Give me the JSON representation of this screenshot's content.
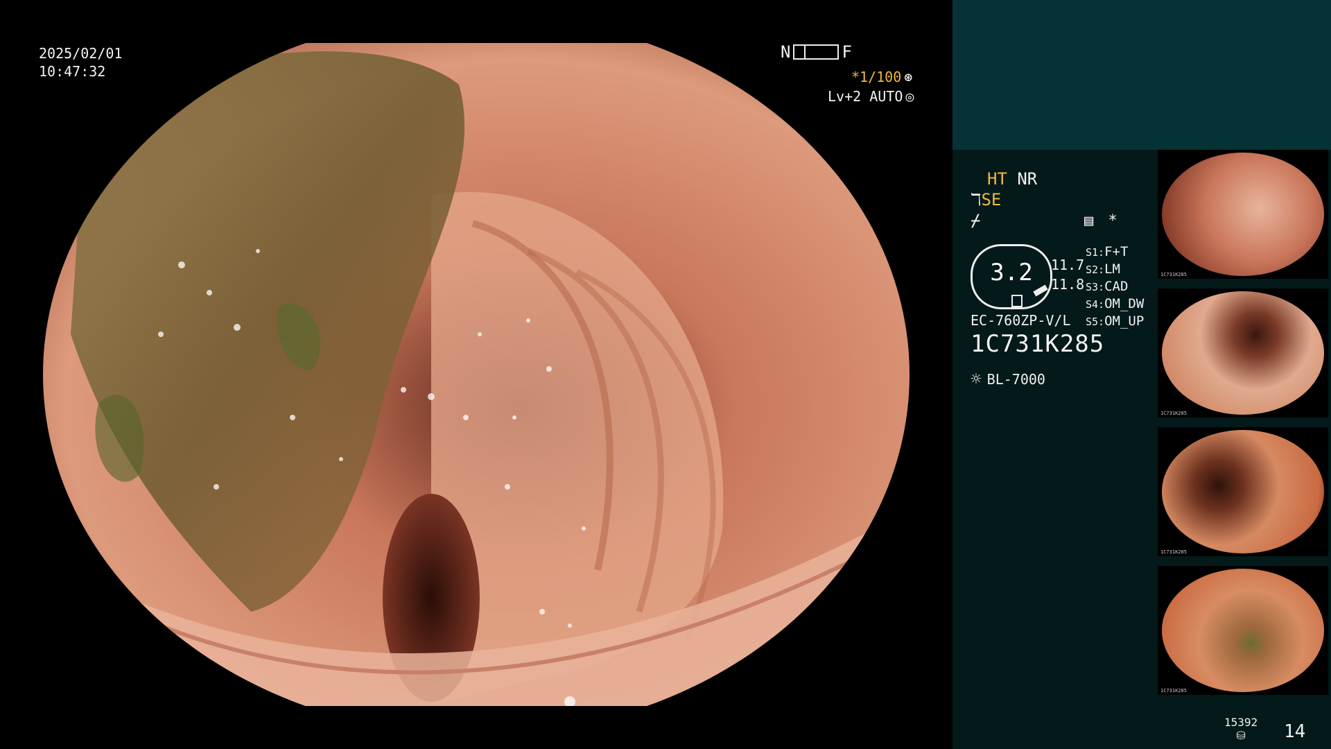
{
  "overlay": {
    "date": "2025/02/01",
    "time": "10:47:32",
    "near_label": "N",
    "far_label": "F",
    "shutter": "*1/100",
    "shutter_icon": "aperture-icon",
    "level": "Lv+2 AUTO",
    "level_icon": "auto-target-icon"
  },
  "panel": {
    "ht": "HT",
    "nr": "NR",
    "se": "SE",
    "settings_star": "*",
    "gauge_value": "3.2",
    "gauge_right_1": "11.7",
    "gauge_right_2": "11.8",
    "slots": [
      {
        "key": "S1:",
        "value": "F+T"
      },
      {
        "key": "S2:",
        "value": "LM"
      },
      {
        "key": "S3:",
        "value": "CAD"
      },
      {
        "key": "S4:",
        "value": "OM_DW"
      },
      {
        "key": "S5:",
        "value": "OM_UP"
      }
    ],
    "model": "EC-760ZP-V/L",
    "scope_id": "1C731K285",
    "light_source": "BL-7000",
    "counter": "15392",
    "page_number": "14",
    "thumbnails": [
      {
        "label": "1C731K285"
      },
      {
        "label": "1C731K285"
      },
      {
        "label": "1C731K285"
      },
      {
        "label": "1C731K285"
      }
    ]
  },
  "colors": {
    "accent_orange": "#f0b83c",
    "panel_bg": "#04191a",
    "panel_top": "#053234",
    "mucosa": "#d98a6a"
  }
}
